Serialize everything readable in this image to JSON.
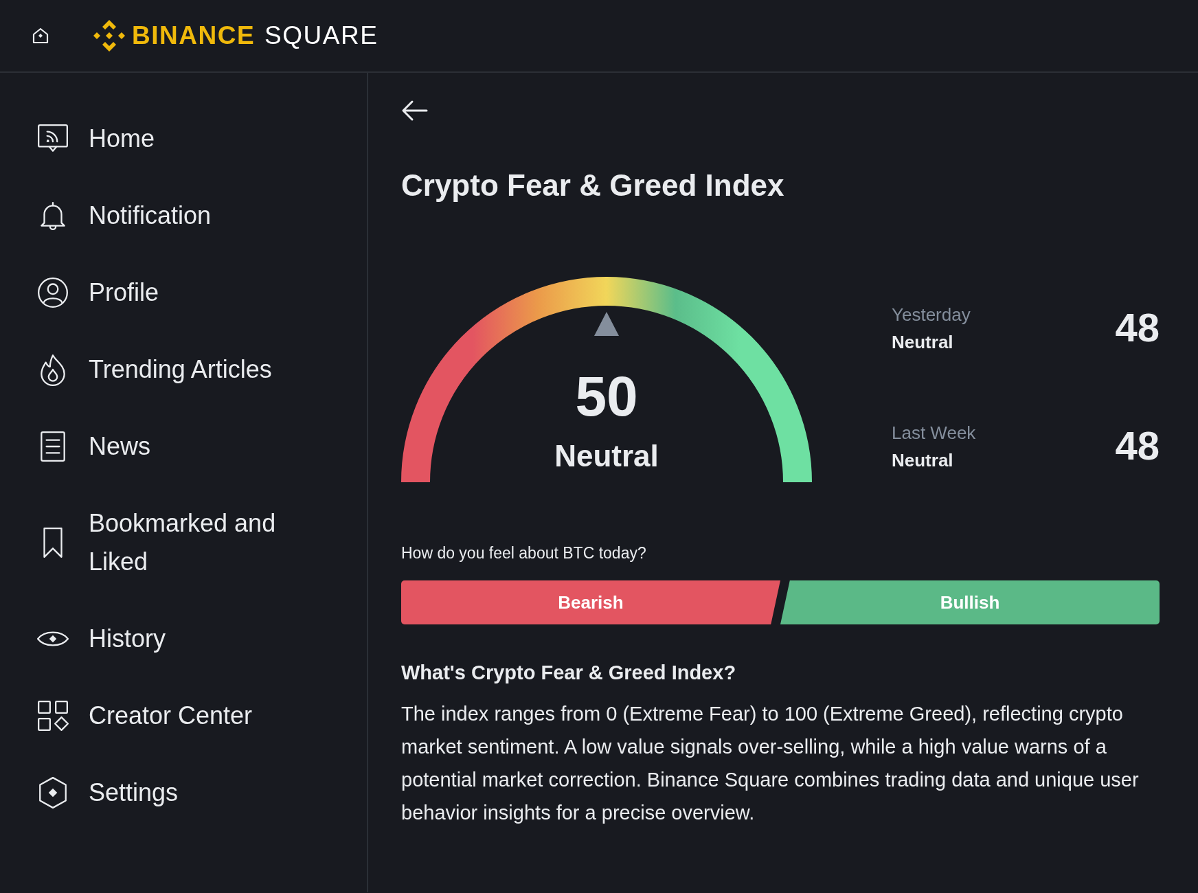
{
  "header": {
    "brand_primary": "BINANCE",
    "brand_secondary": "SQUARE"
  },
  "sidebar": {
    "items": [
      {
        "label": "Home"
      },
      {
        "label": "Notification"
      },
      {
        "label": "Profile"
      },
      {
        "label": "Trending Articles"
      },
      {
        "label": "News"
      },
      {
        "label": "Bookmarked and Liked"
      },
      {
        "label": "History"
      },
      {
        "label": "Creator Center"
      },
      {
        "label": "Settings"
      }
    ]
  },
  "page": {
    "title": "Crypto Fear & Greed Index",
    "gauge": {
      "value": "50",
      "label": "Neutral",
      "level": 0.5
    },
    "history": [
      {
        "period": "Yesterday",
        "label": "Neutral",
        "value": "48"
      },
      {
        "period": "Last Week",
        "label": "Neutral",
        "value": "48"
      }
    ],
    "poll": {
      "question": "How do you feel about BTC today?",
      "options": [
        {
          "label": "Bearish",
          "kind": "bearish"
        },
        {
          "label": "Bullish",
          "kind": "bullish"
        }
      ]
    },
    "about": {
      "heading": "What's Crypto Fear & Greed Index?",
      "text": "The index ranges from 0 (Extreme Fear) to 100 (Extreme Greed), reflecting crypto market sentiment. A low value signals over-selling, while a high value warns of a potential market correction. Binance Square combines trading data and unique user behavior insights for a precise overview."
    }
  }
}
